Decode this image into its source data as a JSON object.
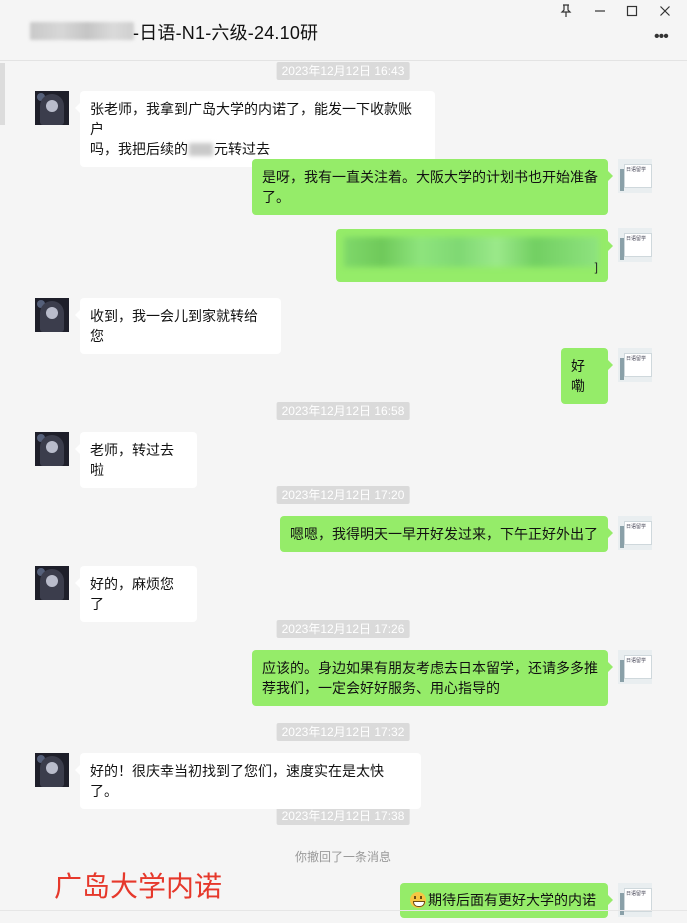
{
  "window": {
    "title": "-日语-N1-六级-24.10研",
    "controls": {
      "pin": "pin-icon",
      "minimize": "minimize-icon",
      "maximize": "maximize-icon",
      "close": "close-icon",
      "more": "more-icon"
    }
  },
  "colors": {
    "incoming_bubble": "#ffffff",
    "outgoing_bubble": "#95ec69",
    "background": "#f5f5f5",
    "watermark": "#e6382b"
  },
  "timestamps": [
    "2023年12月12日 16:43",
    "2023年12月12日 16:58",
    "2023年12月12日 17:20",
    "2023年12月12日 17:26",
    "2023年12月12日 17:32",
    "2023年12月12日 17:38"
  ],
  "messages": [
    {
      "side": "in",
      "line1": "张老师，我拿到广岛大学的内诺了，能发一下收款账户",
      "line2a": "吗，我把后续的",
      "line2b": "元转过去"
    },
    {
      "side": "out",
      "text": "是呀，我有一直关注着。大阪大学的计划书也开始准备了。"
    },
    {
      "side": "out",
      "text": "]"
    },
    {
      "side": "in",
      "text": "收到，我一会儿到家就转给您"
    },
    {
      "side": "out",
      "text": "好嘞"
    },
    {
      "side": "in",
      "text": "老师，转过去啦"
    },
    {
      "side": "out",
      "text": "嗯嗯，我得明天一早开好发过来，下午正好外出了"
    },
    {
      "side": "in",
      "text": "好的，麻烦您了"
    },
    {
      "side": "out",
      "text": "应该的。身边如果有朋友考虑去日本留学，还请多多推荐我们，一定会好好服务、用心指导的"
    },
    {
      "side": "in",
      "text": "好的！很庆幸当初找到了您们，速度实在是太快了。"
    },
    {
      "side": "out",
      "text": "期待后面有更好大学的内诺"
    }
  ],
  "system": {
    "recall_notice": "你撤回了一条消息"
  },
  "watermark": "广岛大学内诺",
  "icons": {
    "emoji": "grinning-face-emoji-icon"
  }
}
